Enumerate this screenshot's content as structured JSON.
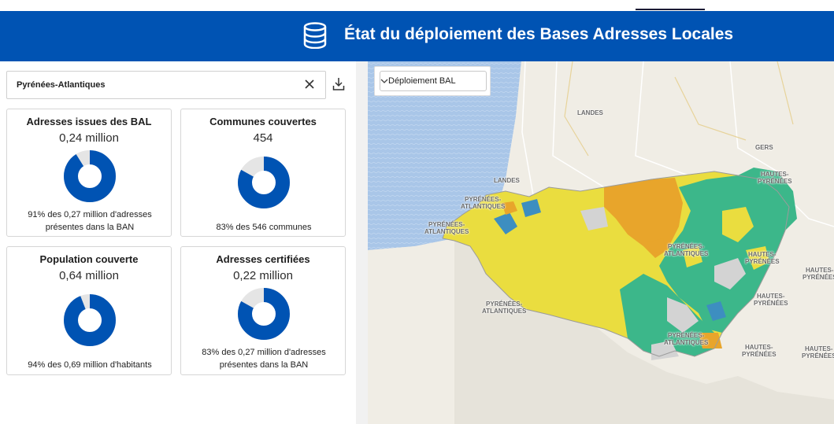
{
  "header": {
    "title": "État du déploiement des Bases Adresses Locales",
    "icon": "database-icon",
    "background": "#0053b3"
  },
  "search": {
    "value": "Pyrénées-Atlantiques",
    "clear_icon": "close-icon",
    "download_icon": "download-icon"
  },
  "cards": [
    {
      "title": "Adresses issues des BAL",
      "value": "0,24 million",
      "percent": 91,
      "note": "91% des 0,27 million d'adresses présentes dans la BAN"
    },
    {
      "title": "Communes couvertes",
      "value": "454",
      "percent": 83,
      "note": "83% des 546 communes"
    },
    {
      "title": "Population couverte",
      "value": "0,64 million",
      "percent": 94,
      "note": "94% des 0,69 million d'habitants"
    },
    {
      "title": "Adresses certifiées",
      "value": "0,22 million",
      "percent": 83,
      "note": "83% des 0,27 million d'adresses présentes dans la BAN"
    }
  ],
  "donut_colors": {
    "filled": "#0053b3",
    "empty": "#e5e5e5"
  },
  "map": {
    "layer_select": "Déploiement BAL",
    "labels": {
      "landes_1": "LANDES",
      "landes_2": "LANDES",
      "gers": "GERS",
      "hp_1": "HAUTES-\nPYRÉNÉES",
      "hp_2": "HAUTES-\nPYRÉNÉES",
      "hp_3": "HAUTES-\nPYRÉNÉES",
      "hp_4": "HAUTES-\nPYRÉNÉES",
      "hp_5": "HAUTES-\nPYRÉNÉES",
      "hp_6": "HAUTES-\nPYRÉNÉES",
      "pa_1": "PYRÉNÉES-\nATLANTIQUES",
      "pa_2": "PYRÉNÉES-\nATLANTIQUES",
      "pa_3": "PYRÉNÉES-\nATLANTIQUES",
      "pa_4": "PYRÉNÉES-\nATLANTIQUES",
      "pa_5": "PYRÉNÉES-\nATLANTIQUES"
    },
    "colors": {
      "yellow": "#eadd3f",
      "orange": "#e8a52b",
      "green": "#3cb78a",
      "blue": "#3d8ec0",
      "gray": "#d3d3d3",
      "sea": "#a9c6e8"
    }
  }
}
